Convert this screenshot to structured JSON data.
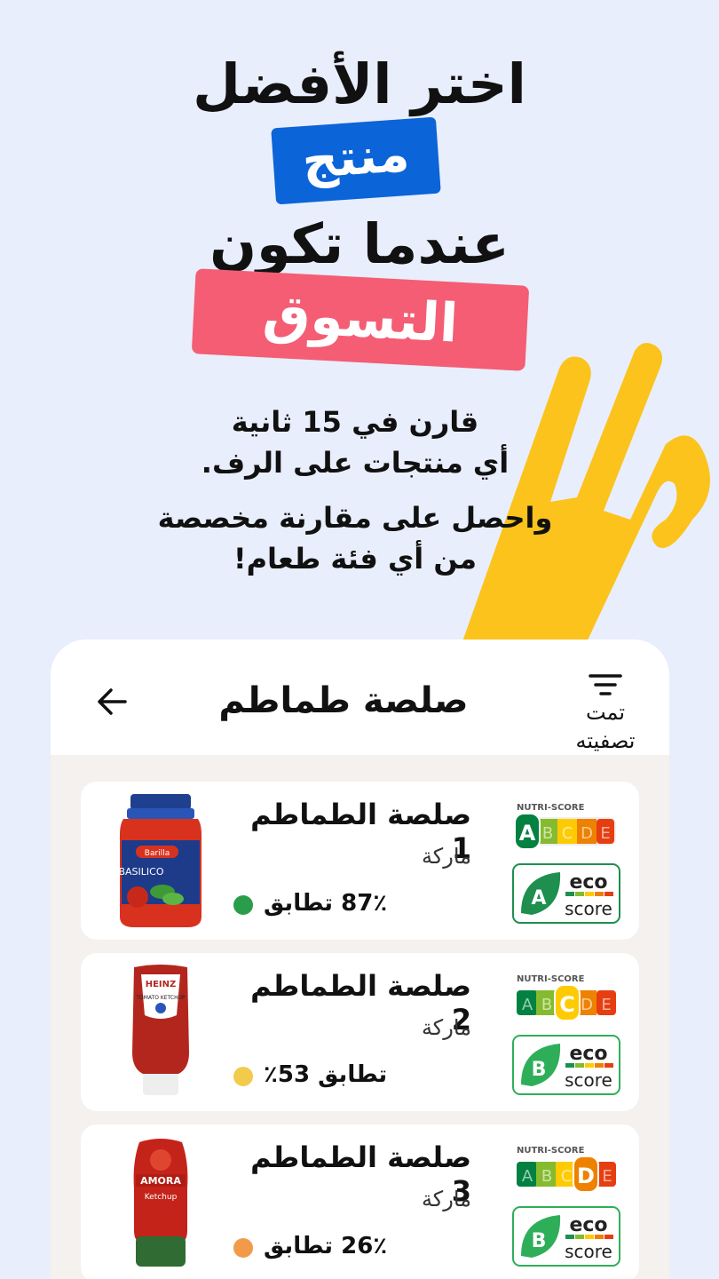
{
  "headline": {
    "line1": "اختر الأفضل",
    "highlight1": "منتج",
    "line3": "عندما تكون",
    "highlight2": "التسوق"
  },
  "subtext": {
    "line1": "قارن في 15 ثانية",
    "line2": "أي منتجات على الرف.",
    "line3": "واحصل على مقارنة مخصصة",
    "line4": "من أي فئة طعام!"
  },
  "colors": {
    "background": "#e8eefb",
    "blue_pill": "#0b64d8",
    "red_pill": "#f45d73",
    "hand": "#fbc31c",
    "card": "#f4f1ee"
  },
  "card": {
    "title": "صلصة طماطم",
    "back_icon": "arrow-left-icon",
    "filter_icon": "filter-icon",
    "filter_label_1": "تمت",
    "filter_label_2": "تصفيته"
  },
  "products": [
    {
      "name": "صلصة الطماطم 1",
      "brand": "ماركة",
      "match": "87٪ تطابق",
      "match_color": "#2a9d4a",
      "nutri_score": "A",
      "eco_score": "A"
    },
    {
      "name": "صلصة الطماطم 2",
      "brand": "ماركة",
      "match": "تطابق 53٪",
      "match_color": "#f2cb4c",
      "nutri_score": "C",
      "eco_score": "B"
    },
    {
      "name": "صلصة الطماطم 3",
      "brand": "ماركة",
      "match": "26٪ تطابق",
      "match_color": "#f09a4a",
      "nutri_score": "D",
      "eco_score": "B"
    }
  ],
  "badges": {
    "nutri_label": "NUTRI-SCORE",
    "nutri_letters": [
      "A",
      "B",
      "C",
      "D",
      "E"
    ],
    "eco_word1": "eco",
    "eco_word2": "score"
  },
  "jar_labels": {
    "p1_brand": "Barilla",
    "p1_variety": "BASILICO",
    "p2_brand": "HEINZ",
    "p2_variety": "TOMATO KETCHUP",
    "p3_brand": "AMORA",
    "p3_variety": "Ketchup"
  }
}
